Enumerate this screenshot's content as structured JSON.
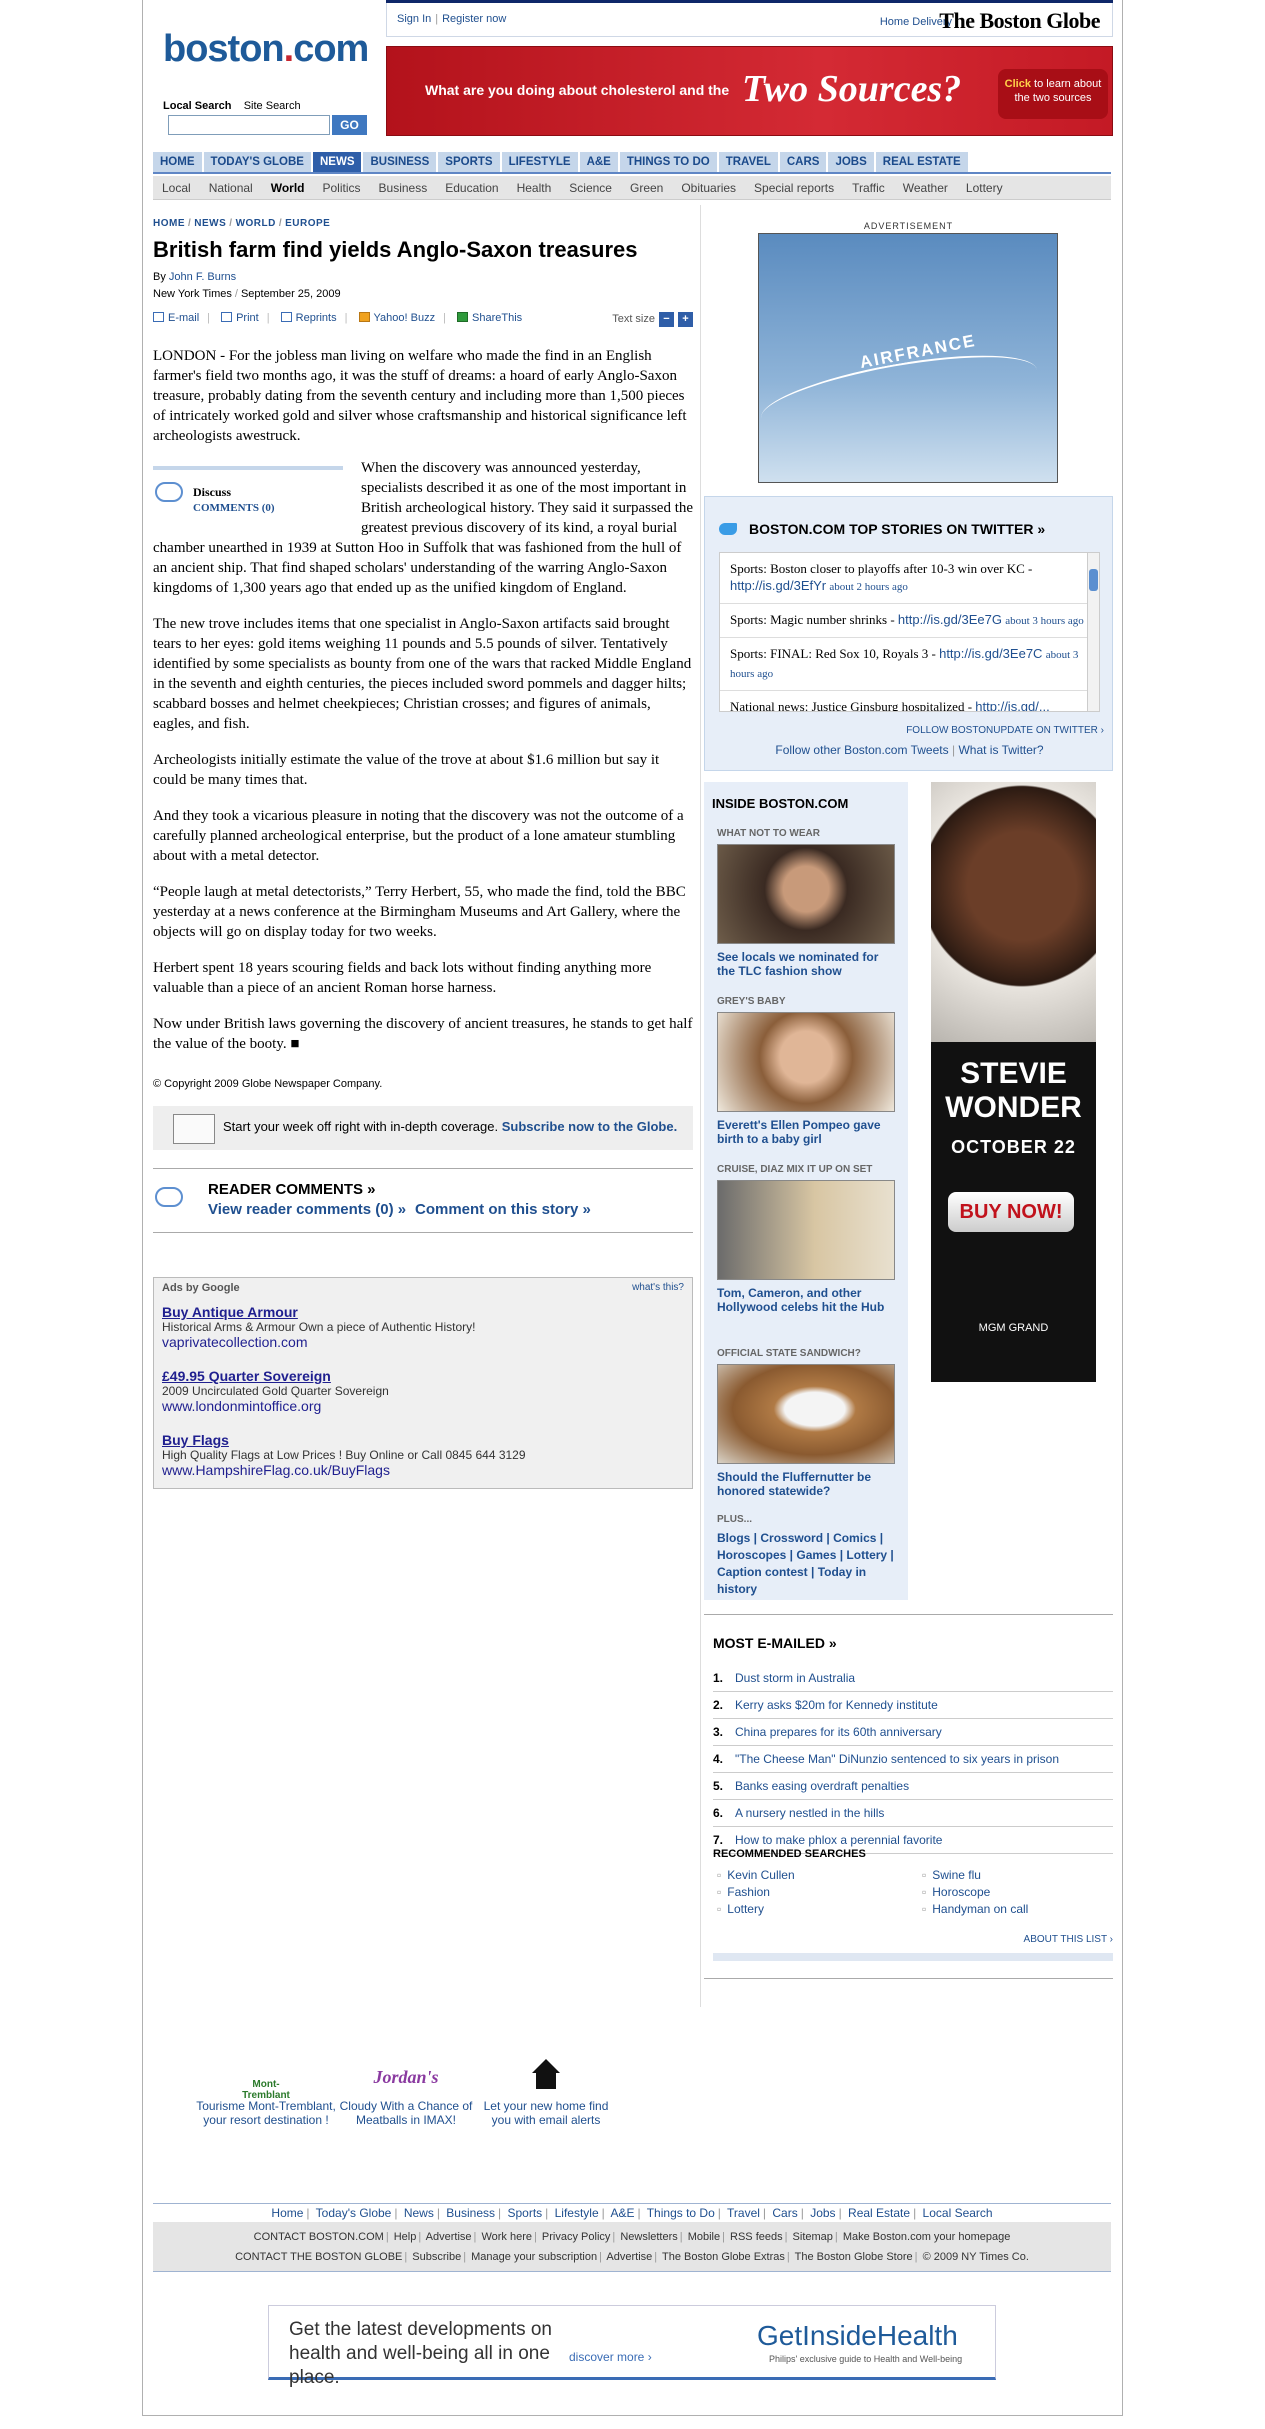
{
  "header": {
    "sign_in": "Sign In",
    "register": "Register now",
    "home_delivery": "Home Delivery",
    "globe_name": "The Boston Globe",
    "logo": "boston.com",
    "search_local": "Local Search",
    "search_site": "Site Search",
    "search_placeholder": "",
    "go": "GO"
  },
  "banner_ad": {
    "text": "What are you doing about cholesterol and the",
    "highlight": "Two Sources?",
    "cta_click": "Click",
    "cta_rest": "to learn about the two sources"
  },
  "nav": [
    "HOME",
    "TODAY'S GLOBE",
    "NEWS",
    "BUSINESS",
    "SPORTS",
    "LIFESTYLE",
    "A&E",
    "THINGS TO DO",
    "TRAVEL",
    "CARS",
    "JOBS",
    "REAL ESTATE"
  ],
  "subnav": [
    "Local",
    "National",
    "World",
    "Politics",
    "Business",
    "Education",
    "Health",
    "Science",
    "Green",
    "Obituaries",
    "Special reports",
    "Traffic",
    "Weather",
    "Lottery"
  ],
  "article": {
    "breadcrumb": [
      "HOME",
      "NEWS",
      "WORLD",
      "EUROPE"
    ],
    "headline": "British farm find yields Anglo-Saxon treasures",
    "by": "By",
    "author": "John F. Burns",
    "source": "New York Times",
    "date": "September 25, 2009",
    "tools": [
      "E-mail",
      "Print",
      "Reprints",
      "Yahoo! Buzz",
      "ShareThis"
    ],
    "text_size": "Text size",
    "p1": "LONDON - For the jobless man living on welfare who made the find in an English farmer's field two months ago, it was the stuff of dreams: a hoard of early Anglo-Saxon treasure, probably dating from the seventh century and including more than 1,500 pieces of intricately worked gold and silver whose craftsmanship and historical significance left archeologists awestruck.",
    "p2": "When the discovery was announced yesterday, specialists described it as one of the most important in British archeological history. They said it surpassed the greatest previous discovery of its kind, a royal burial chamber unearthed in 1939 at Sutton Hoo in Suffolk that was fashioned from the hull of an ancient ship. That find shaped scholars' understanding of the warring Anglo-Saxon kingdoms of 1,300 years ago that ended up as the unified kingdom of England.",
    "p3": "The new trove includes items that one specialist in Anglo-Saxon artifacts said brought tears to her eyes: gold items weighing 11 pounds and 5.5 pounds of silver. Tentatively identified by some specialists as bounty from one of the wars that racked Middle England in the seventh and eighth centuries, the pieces included sword pommels and dagger hilts; scabbard bosses and helmet cheekpieces; Christian crosses; and figures of animals, eagles, and fish.",
    "p4": "Archeologists initially estimate the value of the trove at about $1.6 million but say it could be many times that.",
    "p5": "And they took a vicarious pleasure in noting that the discovery was not the outcome of a carefully planned archeological enterprise, but the product of a lone amateur stumbling about with a metal detector.",
    "p6": "“People laugh at metal detectorists,” Terry Herbert, 55, who made the find, told the BBC yesterday at a news conference at the Birmingham Museums and Art Gallery, where the objects will go on display today for two weeks.",
    "p7": "Herbert spent 18 years scouring fields and back lots without finding anything more valuable than a piece of an ancient Roman horse harness.",
    "p8": "Now under British laws governing the discovery of ancient treasures, he stands to get half the value of the booty. ■",
    "copyright": "© Copyright 2009 Globe Newspaper Company."
  },
  "discuss": {
    "label": "Discuss",
    "comments": "COMMENTS (0)"
  },
  "subscribe": {
    "text": "Start your week off right with in-depth coverage.",
    "link": "Subscribe now to the Globe."
  },
  "reader_comments": {
    "title": "READER COMMENTS »",
    "view": "View reader comments (0) »",
    "comment": "Comment on this story »"
  },
  "google_ads": {
    "header": "Ads by Google",
    "whats_this": "what's this?",
    "items": [
      {
        "title": "Buy Antique Armour",
        "desc": "Historical Arms & Armour Own a piece of Authentic History!",
        "url": "vaprivatecollection.com"
      },
      {
        "title": "£49.95 Quarter Sovereign",
        "desc": "2009 Uncirculated Gold Quarter Sovereign",
        "url": "www.londonmintoffice.org"
      },
      {
        "title": "Buy Flags",
        "desc": "High Quality Flags at Low Prices ! Buy Online or Call 0845 644 3129",
        "url": "www.HampshireFlag.co.uk/BuyFlags"
      }
    ]
  },
  "right_ad": {
    "label": "ADVERTISEMENT",
    "brand": "AIRFRANCE"
  },
  "twitter": {
    "title": "BOSTON.COM TOP STORIES ON TWITTER »",
    "items": [
      {
        "text": "Sports: Boston closer to playoffs after 10-3 win over KC -",
        "link": "http://is.gd/3EfYr",
        "time": "about 2 hours ago"
      },
      {
        "text": "Sports: Magic number shrinks -",
        "link": "http://is.gd/3Ee7G",
        "time": "about 3 hours ago"
      },
      {
        "text": "Sports: FINAL: Red Sox 10, Royals 3 -",
        "link": "http://is.gd/3Ee7C",
        "time": "about 3 hours ago"
      },
      {
        "text": "National news: Justice Ginsburg hospitalized -",
        "link": "http://is.gd/...",
        "time": ""
      }
    ],
    "follow": "FOLLOW BOSTONUPDATE ON TWITTER ›",
    "other": "Follow other Boston.com Tweets",
    "what": "What is Twitter?"
  },
  "inside": {
    "title": "INSIDE BOSTON.COM",
    "items": [
      {
        "label": "WHAT NOT TO WEAR",
        "caption": "See locals we nominated for the TLC fashion show"
      },
      {
        "label": "GREY'S BABY",
        "caption": "Everett's Ellen Pompeo gave birth to a baby girl"
      },
      {
        "label": "CRUISE, DIAZ MIX IT UP ON SET",
        "caption": "Tom, Cameron, and other Hollywood celebs hit the Hub"
      },
      {
        "label": "OFFICIAL STATE SANDWICH?",
        "caption": "Should the Fluffernutter be honored statewide?"
      }
    ],
    "plus": "PLUS...",
    "plus_links": "Blogs | Crossword | Comics | Horoscopes | Games | Lottery | Caption contest | Today in history"
  },
  "stevie_ad": {
    "name_1": "STEVIE",
    "name_2": "WONDER",
    "date": "OCTOBER 22",
    "buy": "BUY NOW!",
    "venue": "MGM GRAND"
  },
  "most_emailed": {
    "title": "MOST E-MAILED »",
    "items": [
      "Dust storm in Australia",
      "Kerry asks $20m for Kennedy institute",
      "China prepares for its 60th anniversary",
      "\"The Cheese Man\" DiNunzio sentenced to six years in prison",
      "Banks easing overdraft penalties",
      "A nursery nestled in the hills",
      "How to make phlox a perennial favorite"
    ]
  },
  "recommended": {
    "title": "RECOMMENDED SEARCHES",
    "col1": [
      "Kevin Cullen",
      "Fashion",
      "Lottery"
    ],
    "col2": [
      "Swine flu",
      "Horoscope",
      "Handyman on call"
    ],
    "about": "ABOUT THIS LIST ›"
  },
  "promos": [
    {
      "logo": "Mont-Tremblant",
      "text": "Tourisme Mont-Tremblant, your resort destination !"
    },
    {
      "logo": "Jordan's",
      "text": "Cloudy With a Chance of Meatballs in IMAX!"
    },
    {
      "logo": "",
      "text": "Let your new home find you with email alerts"
    }
  ],
  "footer": {
    "nav": [
      "Home",
      "Today's Globe",
      "News",
      "Business",
      "Sports",
      "Lifestyle",
      "A&E",
      "Things to Do",
      "Travel",
      "Cars",
      "Jobs",
      "Real Estate",
      "Local Search"
    ],
    "row1": [
      "CONTACT BOSTON.COM",
      "Help",
      "Advertise",
      "Work here",
      "Privacy Policy",
      "Newsletters",
      "Mobile",
      "RSS feeds",
      "Sitemap",
      "Make Boston.com your homepage"
    ],
    "row2": [
      "CONTACT THE BOSTON GLOBE",
      "Subscribe",
      "Manage your subscription",
      "Advertise",
      "The Boston Globe Extras",
      "The Boston Globe Store",
      "© 2009 NY Times Co."
    ]
  },
  "health_ad": {
    "text": "Get the latest developments on health and well-being all in one place.",
    "more": "discover more ›",
    "logo": "GetInsideHealth",
    "tag": "Philips' exclusive guide to Health and Well-being"
  }
}
